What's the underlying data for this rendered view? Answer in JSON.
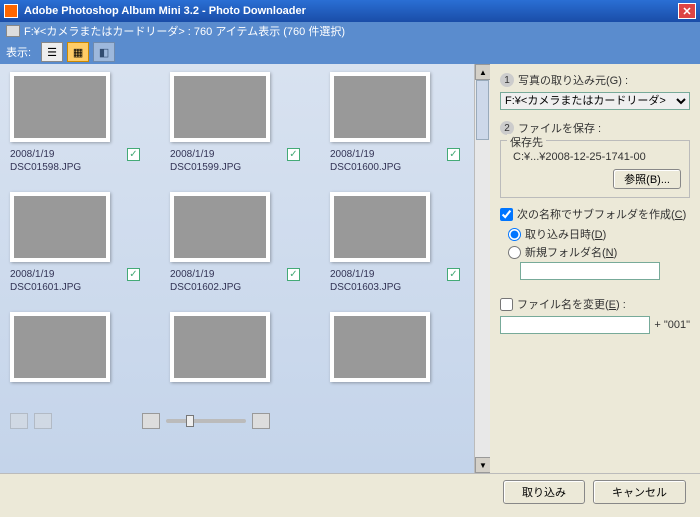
{
  "window": {
    "title": "Adobe Photoshop Album Mini 3.2 - Photo Downloader"
  },
  "subheader": {
    "text": "F:¥<カメラまたはカードリーダ> : 760 アイテム表示 (760 件選択)"
  },
  "toolbar": {
    "label": "表示:"
  },
  "thumbs": [
    {
      "date": "2008/1/19",
      "file": "DSC01598.JPG"
    },
    {
      "date": "2008/1/19",
      "file": "DSC01599.JPG"
    },
    {
      "date": "2008/1/19",
      "file": "DSC01600.JPG"
    },
    {
      "date": "2008/1/19",
      "file": "DSC01601.JPG"
    },
    {
      "date": "2008/1/19",
      "file": "DSC01602.JPG"
    },
    {
      "date": "2008/1/19",
      "file": "DSC01603.JPG"
    },
    {
      "date": "",
      "file": ""
    },
    {
      "date": "",
      "file": ""
    },
    {
      "date": "",
      "file": ""
    }
  ],
  "panel": {
    "step1": "写真の取り込み元(G) :",
    "source_selected": "F:¥<カメラまたはカードリーダ>",
    "step2": "ファイルを保存 :",
    "dest_legend": "保存先",
    "dest_path": "C:¥...¥2008-12-25-1741-00",
    "browse": "参照(B)...",
    "subfolder_check": "次の名称でサブフォルダを作成(C)",
    "radio_date": "取り込み日時(D)",
    "radio_name": "新規フォルダ名(N)",
    "newfolder_value": "",
    "rename_check": "ファイル名を変更(E) :",
    "rename_suffix": "+ \"001\"",
    "rename_value": ""
  },
  "footer": {
    "import": "取り込み",
    "cancel": "キャンセル"
  }
}
